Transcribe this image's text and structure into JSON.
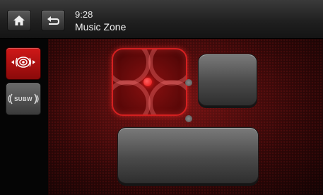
{
  "header": {
    "home_icon": "home-icon",
    "back_icon": "back-icon",
    "time": "9:28",
    "title": "Music Zone"
  },
  "sidebar": {
    "items": [
      {
        "icon": "surround-zone-icon",
        "state": "active"
      },
      {
        "icon": "subwoofer-icon",
        "label": "SUBW",
        "state": "inactive"
      }
    ]
  },
  "zone_map": {
    "focus_icon": "listening-position-pad",
    "accent_color": "#d42020"
  }
}
